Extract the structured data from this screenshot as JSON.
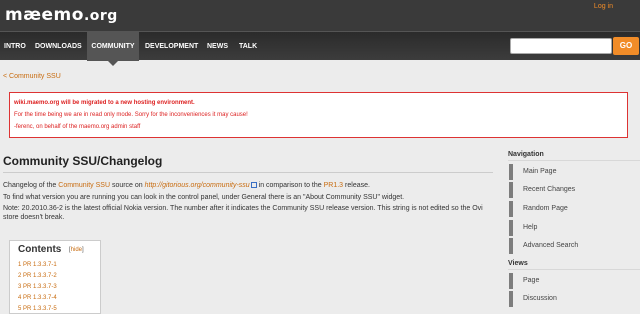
{
  "header": {
    "logo_main": "mæemo",
    "logo_tld": ".org",
    "login": "Log in"
  },
  "nav": {
    "items": [
      "INTRO",
      "DOWNLOADS",
      "COMMUNITY",
      "DEVELOPMENT",
      "NEWS",
      "TALK"
    ],
    "active": "COMMUNITY",
    "search_placeholder": "",
    "search_button": "GO"
  },
  "breadcrumb": "< Community SSU",
  "notice": {
    "line1": "wiki.maemo.org will be migrated to a new hosting environment.",
    "line2": "For the time being we are in read only mode. Sorry for the inconveniences it may cause!",
    "line3": "-ferenc, on behalf of the maemo.org admin staff"
  },
  "page": {
    "title": "Community SSU/Changelog",
    "p1_a": "Changelog of the ",
    "p1_link1": "Community SSU",
    "p1_b": " source on ",
    "p1_link2": "http://gitorious.org/community-ssu",
    "p1_c": " in comparison to the ",
    "p1_link3": "PR1.3",
    "p1_d": " release.",
    "p2": "To find what version you are running you can look in the control panel, under General there is an \"About Community SSU\" widget.",
    "p3": "Note: 20.2010.36-2 is the latest official Nokia version. The number after it indicates the Community SSU release version. This string is not edited so the Ovi store doesn't break."
  },
  "toc": {
    "title": "Contents",
    "hide_open": "[",
    "hide": "hide",
    "hide_close": "]",
    "items": [
      "1 PR 1.3.3.7-1",
      "2 PR 1.3.3.7-2",
      "3 PR 1.3.3.7-3",
      "4 PR 1.3.3.7-4",
      "5 PR 1.3.3.7-5"
    ]
  },
  "sidebar": {
    "navigation_heading": "Navigation",
    "navigation": [
      "Main Page",
      "Recent Changes",
      "Random Page",
      "Help",
      "Advanced Search"
    ],
    "views_heading": "Views",
    "views": [
      "Page",
      "Discussion"
    ]
  },
  "colors": {
    "accent": "#f18c28",
    "header_bg": "#3a3a3a",
    "notice_border": "#dd3333",
    "link": "#c86c10"
  }
}
